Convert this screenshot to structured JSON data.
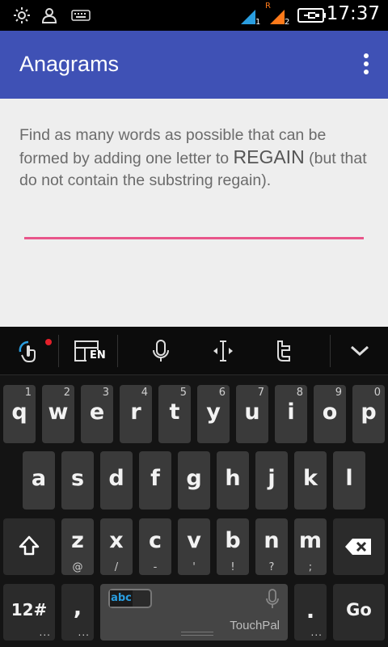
{
  "status_bar": {
    "time": "17:37",
    "icons": [
      "brightness-icon",
      "person-icon",
      "keyboard-icon",
      "signal-1-icon",
      "signal-2-roaming-icon",
      "battery-charging-icon"
    ],
    "sim1_label": "1",
    "sim2_label": "2",
    "roaming_label": "R"
  },
  "app_bar": {
    "title": "Anagrams",
    "menu_icon": "overflow-menu-icon"
  },
  "content": {
    "instruction_pre": "Find as many words as possible that can be formed by adding one letter to ",
    "target_word": "REGAIN",
    "instruction_post": " (but that do not contain the substring regain).",
    "answer_value": ""
  },
  "keyboard_toolbar": {
    "buttons": [
      "gesture-icon",
      "layout-en-icon",
      "microphone-icon",
      "cursor-icon",
      "twitter-icon",
      "collapse-icon"
    ],
    "layout_label": "EN"
  },
  "keyboard": {
    "row1": [
      {
        "key": "q",
        "hint": "1"
      },
      {
        "key": "w",
        "hint": "2"
      },
      {
        "key": "e",
        "hint": "3"
      },
      {
        "key": "r",
        "hint": "4"
      },
      {
        "key": "t",
        "hint": "5"
      },
      {
        "key": "y",
        "hint": "6"
      },
      {
        "key": "u",
        "hint": "7"
      },
      {
        "key": "i",
        "hint": "8"
      },
      {
        "key": "o",
        "hint": "9"
      },
      {
        "key": "p",
        "hint": "0"
      }
    ],
    "row2": [
      {
        "key": "a"
      },
      {
        "key": "s"
      },
      {
        "key": "d"
      },
      {
        "key": "f"
      },
      {
        "key": "g"
      },
      {
        "key": "h"
      },
      {
        "key": "j"
      },
      {
        "key": "k"
      },
      {
        "key": "l"
      }
    ],
    "row3": [
      {
        "key": "z",
        "sub": "@"
      },
      {
        "key": "x",
        "sub": "/"
      },
      {
        "key": "c",
        "sub": "-"
      },
      {
        "key": "v",
        "sub": "'"
      },
      {
        "key": "b",
        "sub": "!"
      },
      {
        "key": "n",
        "sub": "?"
      },
      {
        "key": "m",
        "sub": ";"
      }
    ],
    "symbols_label": "12#",
    "comma_label": ",",
    "period_label": ".",
    "go_label": "Go",
    "abc_label": "abc",
    "brand_label": "TouchPal",
    "more_dots": "..."
  },
  "colors": {
    "app_bar": "#3f51b5",
    "underline": "#e8558a",
    "content_bg": "#eeeeee",
    "abc_accent": "#2a9ee0",
    "notification_dot": "#e3202a"
  }
}
